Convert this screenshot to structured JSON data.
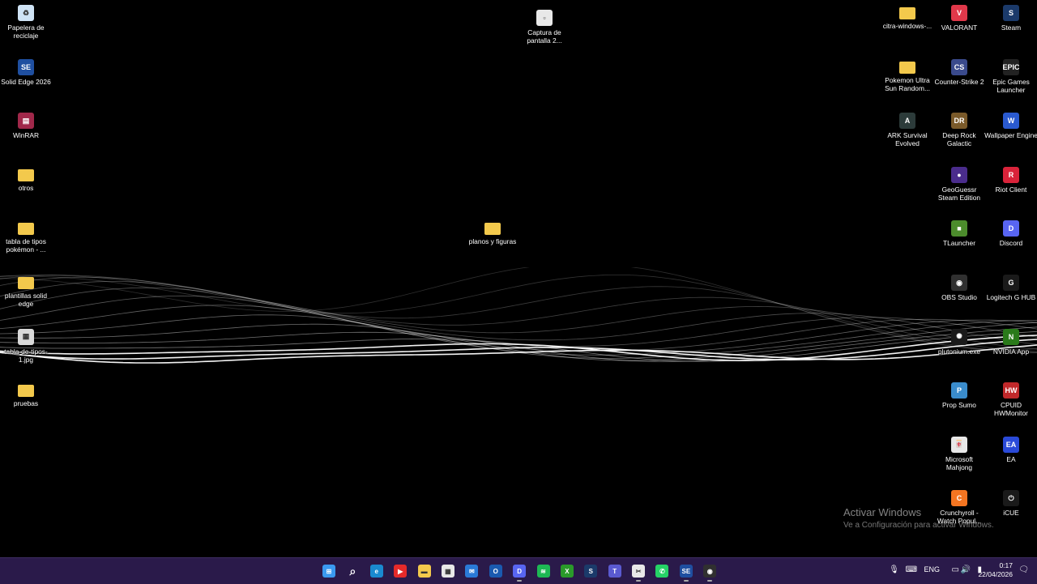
{
  "desktop": {
    "icons_left": [
      {
        "id": "papelera",
        "label": "Papelera de reciclaje",
        "icon": "recycle-bin-icon",
        "color": "#cfe3f5",
        "glyph": "♻",
        "type": "app"
      },
      {
        "id": "solidedge",
        "label": "Solid Edge 2026",
        "icon": "solid-edge-icon",
        "color": "#1f4fa0",
        "glyph": "SE",
        "type": "app"
      },
      {
        "id": "winrar",
        "label": "WinRAR",
        "icon": "winrar-icon",
        "color": "#a0284a",
        "glyph": "▤",
        "type": "app"
      },
      {
        "id": "otros",
        "label": "otros",
        "icon": "folder-icon",
        "color": "#f3c94c",
        "glyph": "",
        "type": "folder"
      },
      {
        "id": "tabla-pokemon",
        "label": "tabla de tipos pokémon - ...",
        "icon": "folder-icon",
        "color": "#f3c94c",
        "glyph": "",
        "type": "folder"
      },
      {
        "id": "plantillas",
        "label": "plantillas solid edge",
        "icon": "folder-icon",
        "color": "#f3c94c",
        "glyph": "",
        "type": "folder"
      },
      {
        "id": "tabla-jpg",
        "label": "tabla-de-tipos-1.jpg",
        "icon": "image-file-icon",
        "color": "#d9d9d9",
        "glyph": "▦",
        "type": "app"
      },
      {
        "id": "pruebas",
        "label": "pruebas",
        "icon": "folder-icon",
        "color": "#f3c94c",
        "glyph": "",
        "type": "folder"
      }
    ],
    "icons_mid": [
      {
        "id": "captura",
        "label": "Captura de pantalla 2...",
        "icon": "screenshot-file-icon",
        "color": "#e8e8e8",
        "glyph": "▫",
        "type": "app"
      },
      {
        "id": "planos",
        "label": "planos y figuras",
        "icon": "folder-icon",
        "color": "#f3c94c",
        "glyph": "",
        "type": "folder"
      }
    ],
    "icons_col1": [
      {
        "id": "citra",
        "label": "citra-windows-...",
        "icon": "folder-icon",
        "color": "#f3c94c",
        "glyph": "",
        "type": "folder"
      },
      {
        "id": "pokemon-ultra",
        "label": "Pokemon Ultra Sun Random...",
        "icon": "folder-icon",
        "color": "#f3c94c",
        "glyph": "",
        "type": "folder"
      },
      {
        "id": "ark",
        "label": "ARK Survival Evolved",
        "icon": "ark-icon",
        "color": "#2c3b3a",
        "glyph": "A",
        "type": "app"
      }
    ],
    "icons_col2": [
      {
        "id": "valorant",
        "label": "VALORANT",
        "icon": "valorant-icon",
        "color": "#e0384a",
        "glyph": "V",
        "type": "app"
      },
      {
        "id": "cs2",
        "label": "Counter-Strike 2",
        "icon": "counter-strike-icon",
        "color": "#3a4a8c",
        "glyph": "CS",
        "type": "app"
      },
      {
        "id": "drg",
        "label": "Deep Rock Galactic",
        "icon": "deep-rock-galactic-icon",
        "color": "#7a5a2a",
        "glyph": "DR",
        "type": "app"
      },
      {
        "id": "geoguessr",
        "label": "GeoGuessr Steam Edition",
        "icon": "geoguessr-icon",
        "color": "#4a2c8c",
        "glyph": "●",
        "type": "app"
      },
      {
        "id": "tlauncher",
        "label": "TLauncher",
        "icon": "tlauncher-icon",
        "color": "#4c8c2c",
        "glyph": "■",
        "type": "app"
      },
      {
        "id": "obs",
        "label": "OBS Studio",
        "icon": "obs-studio-icon",
        "color": "#303030",
        "glyph": "◉",
        "type": "app"
      },
      {
        "id": "plutonium",
        "label": "plutonium.exe",
        "icon": "plutonium-icon",
        "color": "#1a1a1a",
        "glyph": "✺",
        "type": "app"
      },
      {
        "id": "propsumo",
        "label": "Prop Sumo",
        "icon": "prop-sumo-icon",
        "color": "#3a8ccc",
        "glyph": "P",
        "type": "app"
      },
      {
        "id": "mahjong",
        "label": "Microsoft Mahjong",
        "icon": "mahjong-icon",
        "color": "#e8e8e8",
        "glyph": "🀄",
        "type": "app"
      },
      {
        "id": "crunchyroll",
        "label": "Crunchyroll - Watch Popul...",
        "icon": "crunchyroll-icon",
        "color": "#f47521",
        "glyph": "C",
        "type": "app"
      }
    ],
    "icons_col3": [
      {
        "id": "steam",
        "label": "Steam",
        "icon": "steam-icon",
        "color": "#1b3a6a",
        "glyph": "S",
        "type": "app"
      },
      {
        "id": "epic",
        "label": "Epic Games Launcher",
        "icon": "epic-games-icon",
        "color": "#222222",
        "glyph": "EPIC",
        "type": "app"
      },
      {
        "id": "wallpaper",
        "label": "Wallpaper Engine",
        "icon": "wallpaper-engine-icon",
        "color": "#2a5ad0",
        "glyph": "W",
        "type": "app"
      },
      {
        "id": "riot",
        "label": "Riot Client",
        "icon": "riot-client-icon",
        "color": "#d9233a",
        "glyph": "R",
        "type": "app"
      },
      {
        "id": "discord",
        "label": "Discord",
        "icon": "discord-icon",
        "color": "#5865f2",
        "glyph": "D",
        "type": "app"
      },
      {
        "id": "logitech",
        "label": "Logitech G HUB",
        "icon": "logitech-ghub-icon",
        "color": "#1a1a1a",
        "glyph": "G",
        "type": "app"
      },
      {
        "id": "nvidia",
        "label": "NVIDIA App",
        "icon": "nvidia-icon",
        "color": "#2a7a1a",
        "glyph": "N",
        "type": "app"
      },
      {
        "id": "cpuid",
        "label": "CPUID HWMonitor",
        "icon": "hwmonitor-icon",
        "color": "#c0282a",
        "glyph": "HW",
        "type": "app"
      },
      {
        "id": "ea",
        "label": "EA",
        "icon": "ea-icon",
        "color": "#2a4ad8",
        "glyph": "EA",
        "type": "app"
      },
      {
        "id": "icue",
        "label": "iCUE",
        "icon": "icue-icon",
        "color": "#1a1a1a",
        "glyph": "⏻",
        "type": "app"
      }
    ],
    "watermark": {
      "title": "Activar Windows",
      "subtitle": "Ve a Configuración para activar Windows."
    }
  },
  "taskbar": {
    "background": "#2a1a4a",
    "apps": [
      {
        "name": "start-button",
        "icon": "windows-start-icon",
        "color": "#3a9af0",
        "glyph": "⊞",
        "running": false
      },
      {
        "name": "search-button",
        "icon": "search-icon",
        "color": "transparent",
        "glyph": "⌕",
        "running": false
      },
      {
        "name": "taskbar-edge",
        "icon": "edge-icon",
        "color": "#1a8ad0",
        "glyph": "e",
        "running": false
      },
      {
        "name": "taskbar-youtube",
        "icon": "youtube-icon",
        "color": "#e62a2a",
        "glyph": "▶",
        "running": false
      },
      {
        "name": "taskbar-file-explorer",
        "icon": "file-explorer-icon",
        "color": "#f3c94c",
        "glyph": "▬",
        "running": false
      },
      {
        "name": "taskbar-store",
        "icon": "microsoft-store-icon",
        "color": "#e8e8e8",
        "glyph": "▦",
        "running": false
      },
      {
        "name": "taskbar-outlook-mail",
        "icon": "mail-icon",
        "color": "#2a7ad8",
        "glyph": "✉",
        "running": false
      },
      {
        "name": "taskbar-outlook",
        "icon": "outlook-icon",
        "color": "#1a5ab0",
        "glyph": "O",
        "running": false
      },
      {
        "name": "taskbar-discord",
        "icon": "discord-icon",
        "color": "#5865f2",
        "glyph": "D",
        "running": true
      },
      {
        "name": "taskbar-spotify",
        "icon": "spotify-icon",
        "color": "#1db954",
        "glyph": "≋",
        "running": false
      },
      {
        "name": "taskbar-xbox",
        "icon": "xbox-icon",
        "color": "#2a9a2a",
        "glyph": "X",
        "running": false
      },
      {
        "name": "taskbar-steam",
        "icon": "steam-icon",
        "color": "#1b3a6a",
        "glyph": "S",
        "running": false
      },
      {
        "name": "taskbar-teams",
        "icon": "teams-icon",
        "color": "#5a5ad0",
        "glyph": "T",
        "running": false
      },
      {
        "name": "taskbar-snipping",
        "icon": "snipping-tool-icon",
        "color": "#e8e8e8",
        "glyph": "✂",
        "running": true
      },
      {
        "name": "taskbar-whatsapp",
        "icon": "whatsapp-icon",
        "color": "#25d366",
        "glyph": "✆",
        "running": false
      },
      {
        "name": "taskbar-solid-edge",
        "icon": "solid-edge-icon",
        "color": "#1f4fa0",
        "glyph": "SE",
        "running": true
      },
      {
        "name": "taskbar-obs",
        "icon": "obs-studio-icon",
        "color": "#303030",
        "glyph": "◉",
        "running": true
      }
    ],
    "tray": {
      "language": "ENG",
      "time": "0:17",
      "date": "22/04/2026"
    }
  }
}
